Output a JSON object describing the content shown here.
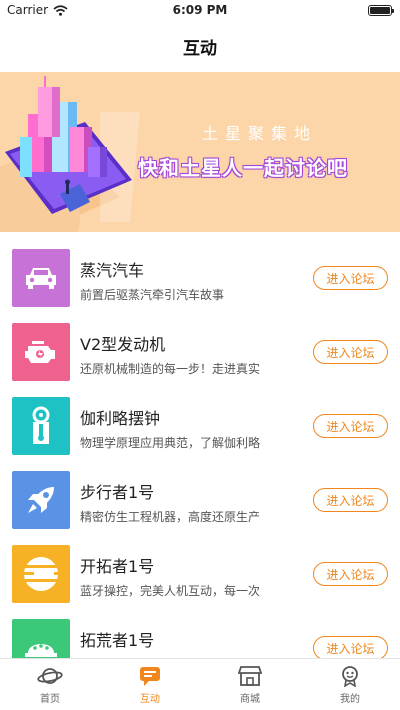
{
  "status_bar": {
    "carrier": "Carrier",
    "time": "6:09 PM"
  },
  "nav": {
    "title": "互动"
  },
  "banner": {
    "subtitle": "土星聚集地",
    "headline": "快和土星人一起讨论吧"
  },
  "forums": [
    {
      "name": "蒸汽汽车",
      "desc": "前置后驱蒸汽牵引汽车故事",
      "button": "进入论坛",
      "icon": "car-icon",
      "color": "#c772d6"
    },
    {
      "name": "V2型发动机",
      "desc": "还原机械制造的每一步！走进真实",
      "button": "进入论坛",
      "icon": "engine-icon",
      "color": "#f0628e"
    },
    {
      "name": "伽利略摆钟",
      "desc": "物理学原理应用典范，了解伽利略",
      "button": "进入论坛",
      "icon": "pendulum-icon",
      "color": "#1ec2c4"
    },
    {
      "name": "步行者1号",
      "desc": "精密仿生工程机器，高度还原生产",
      "button": "进入论坛",
      "icon": "rocket-icon",
      "color": "#5a93e6"
    },
    {
      "name": "开拓者1号",
      "desc": "蓝牙操控，完美人机互动，每一次",
      "button": "进入论坛",
      "icon": "striped-circle-icon",
      "color": "#f7b125"
    },
    {
      "name": "拓荒者1号",
      "desc": "",
      "button": "进入论坛",
      "icon": "dome-icon",
      "color": "#3cc879"
    }
  ],
  "tabs": [
    {
      "label": "首页",
      "icon": "planet-icon",
      "active": false
    },
    {
      "label": "互动",
      "icon": "chat-icon",
      "active": true
    },
    {
      "label": "商城",
      "icon": "store-icon",
      "active": false
    },
    {
      "label": "我的",
      "icon": "profile-icon",
      "active": false
    }
  ],
  "colors": {
    "accent": "#f0861c",
    "banner_bg": "#fcd5a8"
  }
}
